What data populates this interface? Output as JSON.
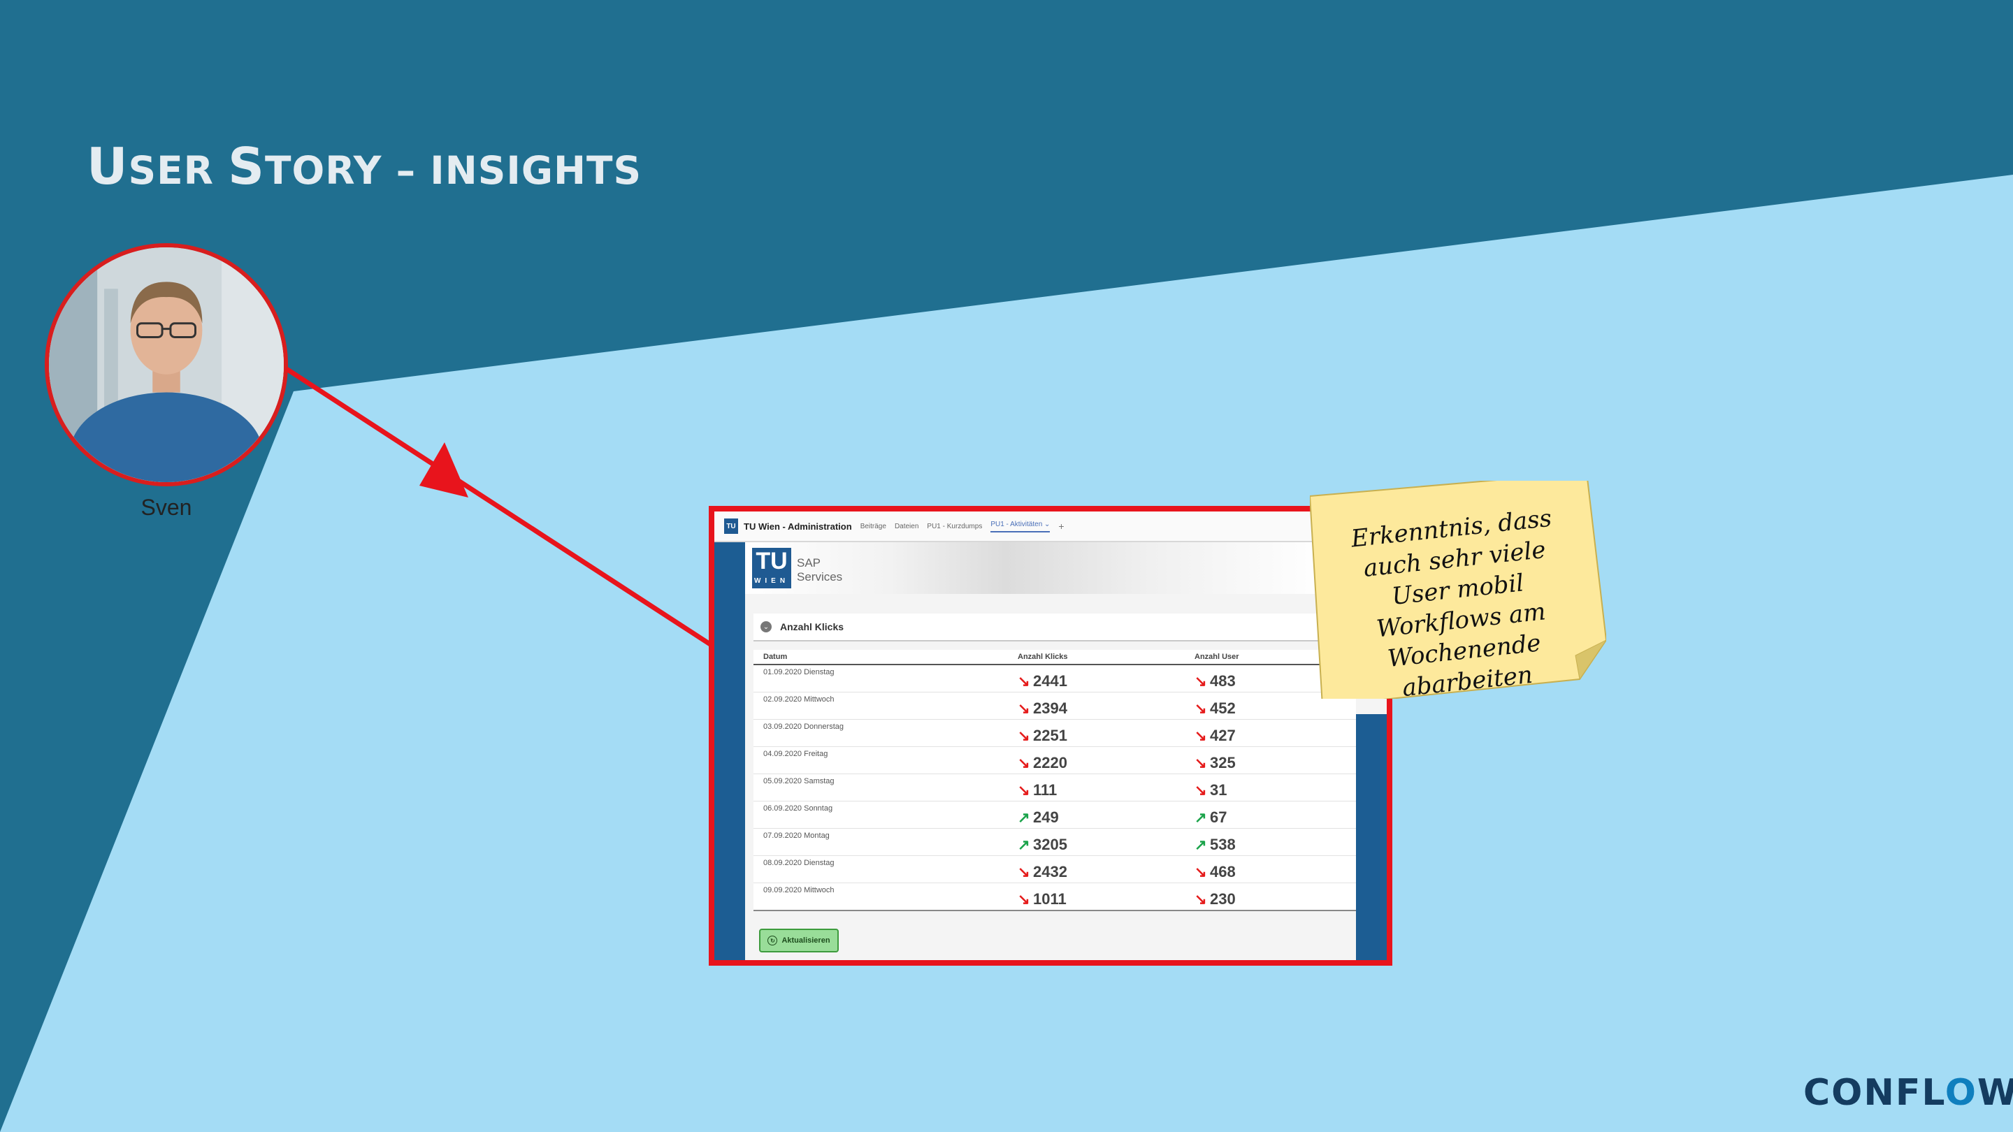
{
  "slide": {
    "title_main1": "U",
    "title_small1": "SER ",
    "title_main2": "S",
    "title_small2": "TORY – INSIGHTS",
    "person_name": "Sven",
    "sticky_note": "Erkenntnis, dass auch sehr viele User mobil Workflows am Wochenende abarbeiten",
    "logo_part1": "CONFL",
    "logo_part2": "O",
    "logo_part3": "W",
    "colors": {
      "dark_blue": "#206f90",
      "light_blue": "#a4dcf5",
      "red": "#e8141c",
      "sticky": "#fde99c"
    }
  },
  "screenshot": {
    "app_logo": "TU",
    "app_title": "TU Wien - Administration",
    "tabs": [
      "Beiträge",
      "Dateien",
      "PU1 - Kurzdumps",
      "PU1 - Aktivitäten ⌄"
    ],
    "add_tab": "+",
    "banner_logo": "TU",
    "banner_logo_sub": "WIEN",
    "banner_text": "SAP Services",
    "section_title": "Anzahl Klicks",
    "columns": [
      "Datum",
      "Anzahl Klicks",
      "Anzahl User"
    ],
    "rows": [
      {
        "date": "01.09.2020 Dienstag",
        "klicks": "2441",
        "klicks_trend": "down",
        "user": "483",
        "user_trend": "down"
      },
      {
        "date": "02.09.2020 Mittwoch",
        "klicks": "2394",
        "klicks_trend": "down",
        "user": "452",
        "user_trend": "down"
      },
      {
        "date": "03.09.2020 Donnerstag",
        "klicks": "2251",
        "klicks_trend": "down",
        "user": "427",
        "user_trend": "down"
      },
      {
        "date": "04.09.2020 Freitag",
        "klicks": "2220",
        "klicks_trend": "down",
        "user": "325",
        "user_trend": "down"
      },
      {
        "date": "05.09.2020 Samstag",
        "klicks": "111",
        "klicks_trend": "down",
        "user": "31",
        "user_trend": "down"
      },
      {
        "date": "06.09.2020 Sonntag",
        "klicks": "249",
        "klicks_trend": "up",
        "user": "67",
        "user_trend": "up"
      },
      {
        "date": "07.09.2020 Montag",
        "klicks": "3205",
        "klicks_trend": "up",
        "user": "538",
        "user_trend": "up"
      },
      {
        "date": "08.09.2020 Dienstag",
        "klicks": "2432",
        "klicks_trend": "down",
        "user": "468",
        "user_trend": "down"
      },
      {
        "date": "09.09.2020 Mittwoch",
        "klicks": "1011",
        "klicks_trend": "down",
        "user": "230",
        "user_trend": "down"
      }
    ],
    "refresh_label": "Aktualisieren"
  }
}
